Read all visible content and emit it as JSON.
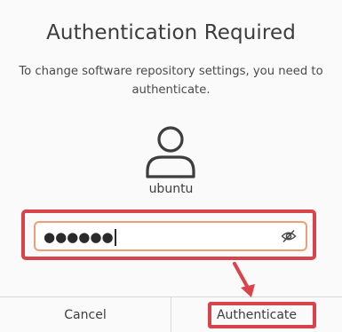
{
  "dialog": {
    "title": "Authentication Required",
    "message": "To change software repository settings, you need to authenticate.",
    "username": "ubuntu",
    "password_masked": "●●●●●●",
    "cancel_label": "Cancel",
    "authenticate_label": "Authenticate"
  },
  "icons": {
    "avatar": "user-avatar-icon",
    "reveal": "eye-slash-icon"
  },
  "colors": {
    "annotation": "#d9434a",
    "field_focus_border": "#e9a07a",
    "background": "#fafafa"
  }
}
